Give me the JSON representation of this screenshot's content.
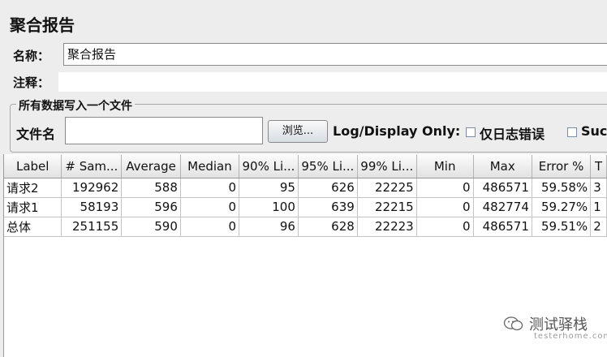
{
  "panel": {
    "title": "聚合报告",
    "name_label": "名称：",
    "name_value": "聚合报告",
    "comment_label": "注释："
  },
  "file_section": {
    "legend": "所有数据写入一个文件",
    "filename_label": "文件名",
    "browse_button": "浏览...",
    "log_display_label": "Log/Display Only:",
    "errors_only_label": "仅日志错误",
    "successes_label": "Suc"
  },
  "table": {
    "columns": [
      "Label",
      "# Sam...",
      "Average",
      "Median",
      "90% Li...",
      "95% Li...",
      "99% Li...",
      "Min",
      "Max",
      "Error %",
      "T"
    ],
    "rows": [
      [
        "请求2",
        "192962",
        "588",
        "0",
        "95",
        "626",
        "22225",
        "0",
        "486571",
        "59.58%",
        "3"
      ],
      [
        "请求1",
        "58193",
        "596",
        "0",
        "100",
        "639",
        "22215",
        "0",
        "482774",
        "59.27%",
        "1"
      ],
      [
        "总体",
        "251155",
        "590",
        "0",
        "96",
        "628",
        "22223",
        "0",
        "486571",
        "59.51%",
        "2"
      ]
    ]
  },
  "watermark": {
    "text": "测试驿栈",
    "sub": "testerhome.com"
  }
}
